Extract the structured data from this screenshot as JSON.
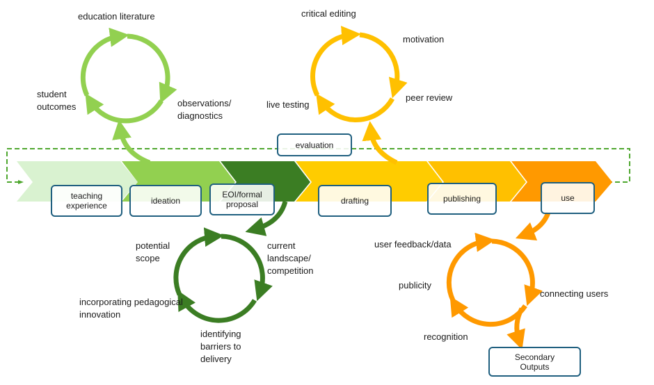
{
  "colors": {
    "stage_teaching": "#d9f2d0",
    "stage_ideation": "#92d050",
    "stage_proposal": "#3b7d23",
    "stage_drafting": "#ffcc00",
    "stage_publishing": "#ffc000",
    "stage_use": "#ff9900",
    "box_border": "#1f5f7f",
    "feedback_loop": "#4ea72e"
  },
  "pipeline": {
    "stages": [
      {
        "id": "teaching",
        "label": "teaching experience"
      },
      {
        "id": "ideation",
        "label": "ideation"
      },
      {
        "id": "proposal",
        "label": "EOI/formal proposal"
      },
      {
        "id": "drafting",
        "label": "drafting"
      },
      {
        "id": "publishing",
        "label": "publishing"
      },
      {
        "id": "use",
        "label": "use"
      }
    ],
    "evaluation_label": "evaluation"
  },
  "cycles": {
    "ideation": {
      "items": [
        "education literature",
        "observations/ diagnostics",
        "student outcomes"
      ]
    },
    "drafting": {
      "items": [
        "critical editing",
        "motivation",
        "peer review",
        "live testing"
      ]
    },
    "proposal": {
      "items": [
        "current landscape/ competition",
        "identifying barriers to delivery",
        "incorporating pedagogical innovation",
        "potential scope"
      ]
    },
    "use": {
      "items": [
        "user feedback/data",
        "connecting users",
        "recognition",
        "publicity"
      ],
      "output_label": "Secondary Outputs"
    }
  }
}
